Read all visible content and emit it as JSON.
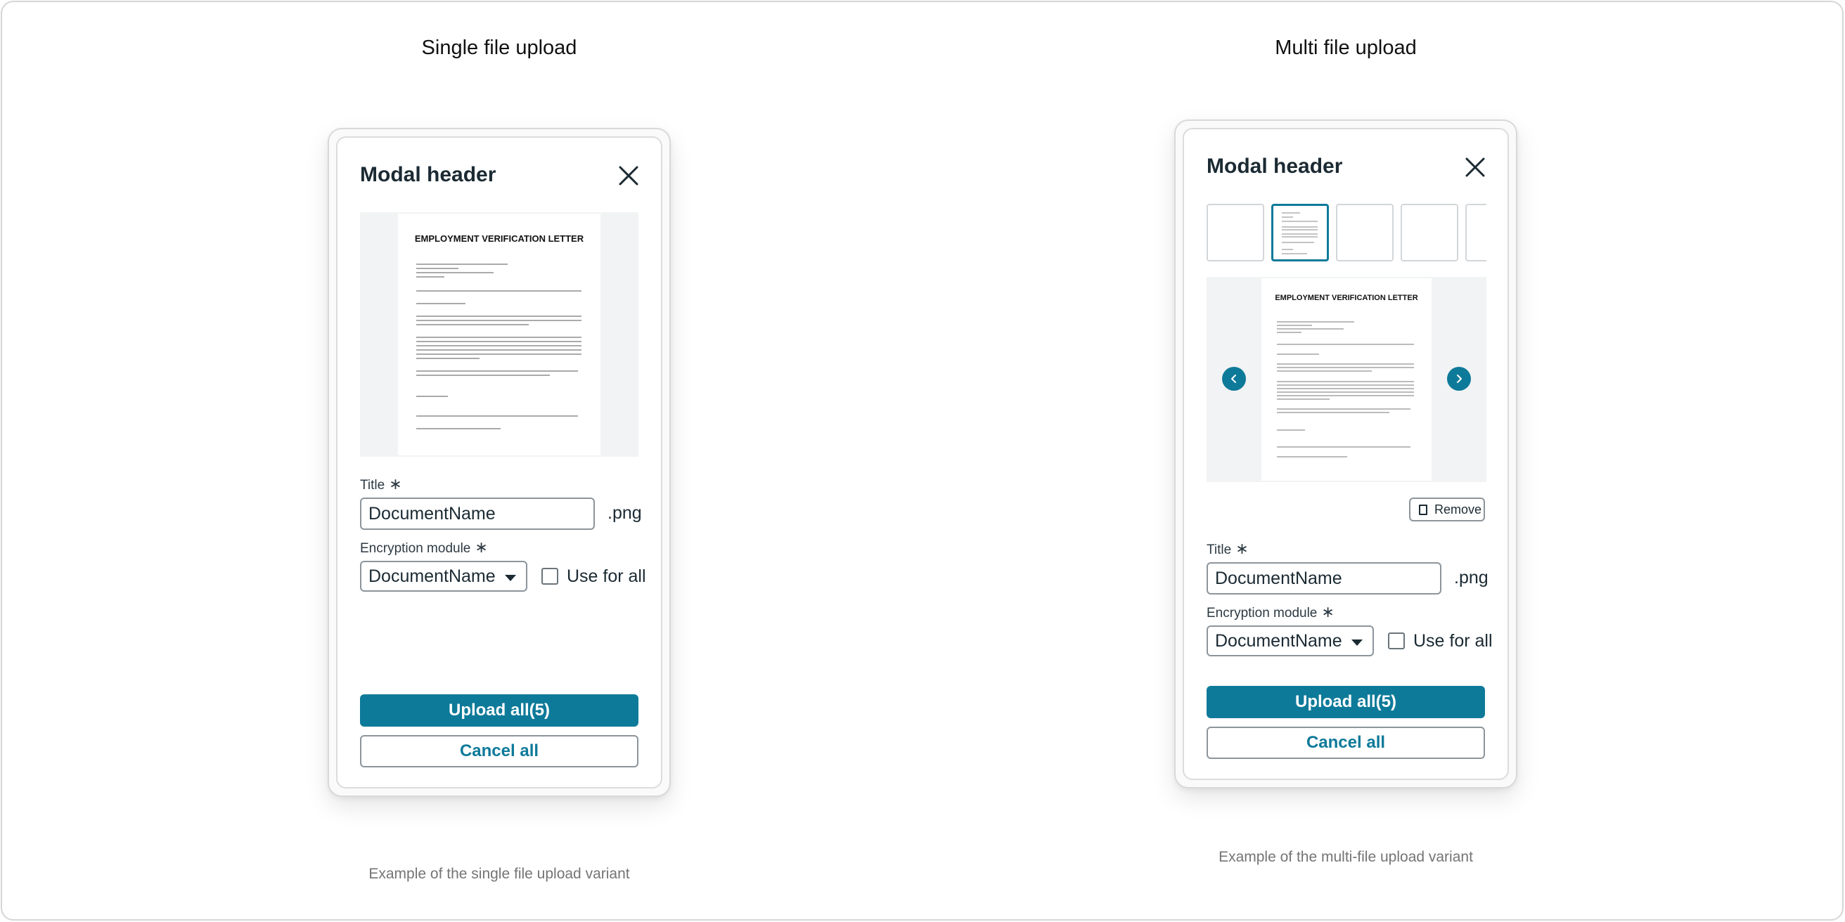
{
  "single": {
    "section_title": "Single file upload",
    "caption": "Example of the single file upload variant",
    "modal_header": "Modal header",
    "document": {
      "title": "EMPLOYMENT VERIFICATION LETTER"
    },
    "title_field": {
      "label": "Title",
      "required_mark": "∗",
      "value": "DocumentName",
      "extension": ".png"
    },
    "encryption_field": {
      "label": "Encryption module",
      "required_mark": "∗",
      "value": "DocumentName"
    },
    "use_for_all_label": "Use for all",
    "upload_button": "Upload all(5)",
    "cancel_button": "Cancel all"
  },
  "multi": {
    "section_title": "Multi file upload",
    "caption": "Example of the multi-file upload variant",
    "modal_header": "Modal header",
    "document": {
      "title": "EMPLOYMENT VERIFICATION LETTER"
    },
    "remove_button": "Remove",
    "title_field": {
      "label": "Title",
      "required_mark": "∗",
      "value": "DocumentName",
      "extension": ".png"
    },
    "encryption_field": {
      "label": "Encryption module",
      "required_mark": "∗",
      "value": "DocumentName"
    },
    "use_for_all_label": "Use for all",
    "upload_button": "Upload all(5)",
    "cancel_button": "Cancel all"
  },
  "colors": {
    "accent": "#0e7a99",
    "border": "#8c959c",
    "preview_bg": "#f2f3f4"
  }
}
